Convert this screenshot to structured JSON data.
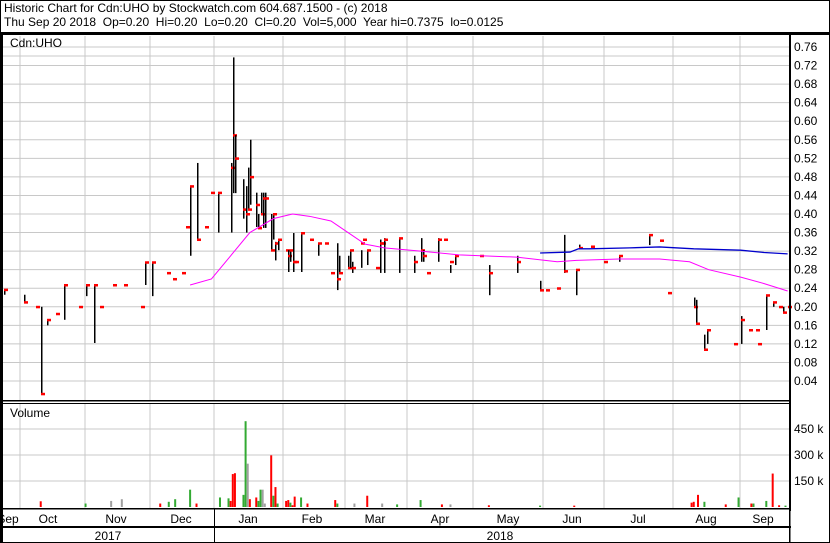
{
  "header": {
    "line1": "Historic Chart for Cdn:UHO by Stockwatch.com 604.687.1500 - (c) 2018",
    "line2": "Thu Sep 20 2018  Op=0.20  Hi=0.20  Lo=0.20  Cl=0.20  Vol=5,000  Year hi=0.7375  lo=0.0125"
  },
  "colors": {
    "close_tick": "#ff0000",
    "bar": "#000000",
    "ma_short": "#ff00ff",
    "ma_long": "#0000cc",
    "vol_up": "#33aa33",
    "vol_down": "#ff0000",
    "vol_flat": "#a0a0a0",
    "grid": "#c8c8c8"
  },
  "chart_data": [
    {
      "type": "ohlc",
      "title": "Cdn:UHO",
      "ylim": [
        0,
        0.78
      ],
      "y_ticks": [
        "0.04",
        "0.08",
        "0.12",
        "0.16",
        "0.20",
        "0.24",
        "0.28",
        "0.32",
        "0.36",
        "0.40",
        "0.44",
        "0.48",
        "0.52",
        "0.56",
        "0.60",
        "0.64",
        "0.68",
        "0.72",
        "0.76"
      ],
      "grid": true,
      "bars_fields": [
        "date",
        "high",
        "low",
        "close"
      ],
      "bars": [
        [
          "2017-09-12",
          0.237,
          0.226,
          0.237
        ],
        [
          "2017-09-21",
          0.226,
          0.21,
          0.21
        ],
        [
          "2017-09-27",
          0.2,
          0.2,
          0.2
        ],
        [
          "2017-09-29",
          0.2,
          0.0125,
          0.0125
        ],
        [
          "2017-10-02",
          0.172,
          0.16,
          0.172
        ],
        [
          "2017-10-06",
          0.185,
          0.185,
          0.185
        ],
        [
          "2017-10-10",
          0.247,
          0.172,
          0.247
        ],
        [
          "2017-10-17",
          0.2,
          0.2,
          0.2
        ],
        [
          "2017-10-20",
          0.247,
          0.223,
          0.247
        ],
        [
          "2017-10-24",
          0.247,
          0.122,
          0.247
        ],
        [
          "2017-10-27",
          0.2,
          0.2,
          0.2
        ],
        [
          "2017-11-02",
          0.247,
          0.247,
          0.247
        ],
        [
          "2017-11-07",
          0.247,
          0.247,
          0.247
        ],
        [
          "2017-11-15",
          0.2,
          0.2,
          0.2
        ],
        [
          "2017-11-17",
          0.296,
          0.247,
          0.296
        ],
        [
          "2017-11-20",
          0.296,
          0.223,
          0.296
        ],
        [
          "2017-11-27",
          0.273,
          0.273,
          0.273
        ],
        [
          "2017-11-30",
          0.26,
          0.26,
          0.26
        ],
        [
          "2017-12-04",
          0.273,
          0.273,
          0.273
        ],
        [
          "2017-12-06",
          0.372,
          0.372,
          0.372
        ],
        [
          "2017-12-08",
          0.46,
          0.31,
          0.46
        ],
        [
          "2017-12-11",
          0.51,
          0.345,
          0.345
        ],
        [
          "2017-12-15",
          0.372,
          0.372,
          0.372
        ],
        [
          "2017-12-18",
          0.446,
          0.446,
          0.446
        ],
        [
          "2017-12-21",
          0.446,
          0.36,
          0.446
        ],
        [
          "2017-12-27",
          0.51,
          0.36,
          0.5
        ],
        [
          "2017-12-28",
          0.7375,
          0.445,
          0.57
        ],
        [
          "2017-12-29",
          0.57,
          0.445,
          0.52
        ],
        [
          "2018-01-02",
          0.475,
          0.39,
          0.41
        ],
        [
          "2018-01-03",
          0.46,
          0.36,
          0.4
        ],
        [
          "2018-01-04",
          0.5,
          0.41,
          0.41
        ],
        [
          "2018-01-05",
          0.56,
          0.42,
          0.48
        ],
        [
          "2018-01-08",
          0.446,
          0.372,
          0.42
        ],
        [
          "2018-01-09",
          0.4,
          0.37,
          0.37
        ],
        [
          "2018-01-10",
          0.446,
          0.4,
          0.4
        ],
        [
          "2018-01-11",
          0.446,
          0.37,
          0.434
        ],
        [
          "2018-01-12",
          0.446,
          0.37,
          0.434
        ],
        [
          "2018-01-15",
          0.4,
          0.322,
          0.322
        ],
        [
          "2018-01-16",
          0.4,
          0.345,
          0.4
        ],
        [
          "2018-01-17",
          0.34,
          0.3,
          0.337
        ],
        [
          "2018-01-18",
          0.345,
          0.322,
          0.345
        ],
        [
          "2018-01-22",
          0.322,
          0.322,
          0.322
        ],
        [
          "2018-01-23",
          0.322,
          0.275,
          0.31
        ],
        [
          "2018-01-24",
          0.322,
          0.297,
          0.322
        ],
        [
          "2018-01-25",
          0.359,
          0.275,
          0.297
        ],
        [
          "2018-01-26",
          0.297,
          0.297,
          0.297
        ],
        [
          "2018-01-29",
          0.359,
          0.275,
          0.359
        ],
        [
          "2018-02-02",
          0.345,
          0.345,
          0.345
        ],
        [
          "2018-02-06",
          0.337,
          0.31,
          0.337
        ],
        [
          "2018-02-09",
          0.337,
          0.337,
          0.337
        ],
        [
          "2018-02-12",
          0.273,
          0.273,
          0.273
        ],
        [
          "2018-02-15",
          0.337,
          0.236,
          0.26
        ],
        [
          "2018-02-16",
          0.31,
          0.273,
          0.273
        ],
        [
          "2018-02-20",
          0.31,
          0.284,
          0.284
        ],
        [
          "2018-02-21",
          0.322,
          0.284,
          0.322
        ],
        [
          "2018-02-22",
          0.297,
          0.273,
          0.284
        ],
        [
          "2018-02-26",
          0.322,
          0.284,
          0.337
        ],
        [
          "2018-02-27",
          0.345,
          0.345,
          0.345
        ],
        [
          "2018-03-01",
          0.322,
          0.29,
          0.322
        ],
        [
          "2018-03-05",
          0.284,
          0.284,
          0.284
        ],
        [
          "2018-03-07",
          0.345,
          0.273,
          0.337
        ],
        [
          "2018-03-08",
          0.337,
          0.337,
          0.337
        ],
        [
          "2018-03-09",
          0.348,
          0.273,
          0.345
        ],
        [
          "2018-03-16",
          0.348,
          0.273,
          0.348
        ],
        [
          "2018-03-23",
          0.31,
          0.273,
          0.297
        ],
        [
          "2018-03-26",
          0.348,
          0.297,
          0.322
        ],
        [
          "2018-03-27",
          0.322,
          0.297,
          0.31
        ],
        [
          "2018-03-29",
          0.273,
          0.273,
          0.273
        ],
        [
          "2018-04-03",
          0.348,
          0.297,
          0.345
        ],
        [
          "2018-04-06",
          0.345,
          0.345,
          0.345
        ],
        [
          "2018-04-09",
          0.29,
          0.273,
          0.297
        ],
        [
          "2018-04-11",
          0.31,
          0.29,
          0.31
        ],
        [
          "2018-04-23",
          0.31,
          0.31,
          0.31
        ],
        [
          "2018-04-27",
          0.29,
          0.225,
          0.273
        ],
        [
          "2018-05-10",
          0.31,
          0.273,
          0.297
        ],
        [
          "2018-05-21",
          0.256,
          0.236,
          0.236
        ],
        [
          "2018-05-24",
          0.236,
          0.236,
          0.236
        ],
        [
          "2018-05-29",
          0.24,
          0.24,
          0.24
        ],
        [
          "2018-06-01",
          0.355,
          0.273,
          0.277
        ],
        [
          "2018-06-07",
          0.28,
          0.225,
          0.28
        ],
        [
          "2018-06-08",
          0.334,
          0.327,
          0.327
        ],
        [
          "2018-06-14",
          0.33,
          0.33,
          0.33
        ],
        [
          "2018-06-20",
          0.297,
          0.297,
          0.297
        ],
        [
          "2018-06-27",
          0.31,
          0.297,
          0.31
        ],
        [
          "2018-07-11",
          0.355,
          0.333,
          0.355
        ],
        [
          "2018-07-16",
          0.343,
          0.343,
          0.343
        ],
        [
          "2018-07-20",
          0.23,
          0.23,
          0.23
        ],
        [
          "2018-08-01",
          0.22,
          0.2,
          0.2
        ],
        [
          "2018-08-02",
          0.215,
          0.164,
          0.164
        ],
        [
          "2018-08-06",
          0.14,
          0.108,
          0.108
        ],
        [
          "2018-08-07",
          0.15,
          0.12,
          0.15
        ],
        [
          "2018-08-20",
          0.12,
          0.12,
          0.12
        ],
        [
          "2018-08-23",
          0.18,
          0.12,
          0.172
        ],
        [
          "2018-08-27",
          0.15,
          0.15,
          0.15
        ],
        [
          "2018-08-30",
          0.15,
          0.15,
          0.15
        ],
        [
          "2018-08-31",
          0.12,
          0.12,
          0.12
        ],
        [
          "2018-09-04",
          0.225,
          0.15,
          0.225
        ],
        [
          "2018-09-07",
          0.21,
          0.2,
          0.21
        ],
        [
          "2018-09-10",
          0.2,
          0.2,
          0.2
        ],
        [
          "2018-09-12",
          0.2,
          0.188,
          0.188
        ],
        [
          "2018-09-14",
          0.2,
          0.2,
          0.2
        ]
      ],
      "ma_short": [
        [
          "2017-12-08",
          0.247
        ],
        [
          "2017-12-18",
          0.26
        ],
        [
          "2017-12-27",
          0.31
        ],
        [
          "2018-01-05",
          0.36
        ],
        [
          "2018-01-16",
          0.39
        ],
        [
          "2018-01-25",
          0.4
        ],
        [
          "2018-02-02",
          0.395
        ],
        [
          "2018-02-12",
          0.385
        ],
        [
          "2018-02-20",
          0.36
        ],
        [
          "2018-02-28",
          0.335
        ],
        [
          "2018-03-09",
          0.327
        ],
        [
          "2018-03-26",
          0.32
        ],
        [
          "2018-04-13",
          0.312
        ],
        [
          "2018-05-10",
          0.307
        ],
        [
          "2018-05-29",
          0.297
        ],
        [
          "2018-06-07",
          0.3
        ],
        [
          "2018-06-27",
          0.303
        ],
        [
          "2018-07-16",
          0.303
        ],
        [
          "2018-07-30",
          0.297
        ],
        [
          "2018-08-08",
          0.28
        ],
        [
          "2018-08-23",
          0.264
        ],
        [
          "2018-09-03",
          0.25
        ],
        [
          "2018-09-14",
          0.234
        ]
      ],
      "ma_long": [
        [
          "2018-05-21",
          0.316
        ],
        [
          "2018-06-04",
          0.318
        ],
        [
          "2018-06-08",
          0.325
        ],
        [
          "2018-06-13",
          0.325
        ],
        [
          "2018-07-02",
          0.327
        ],
        [
          "2018-07-16",
          0.329
        ],
        [
          "2018-08-01",
          0.325
        ],
        [
          "2018-08-23",
          0.322
        ],
        [
          "2018-09-03",
          0.317
        ],
        [
          "2018-09-14",
          0.314
        ]
      ]
    },
    {
      "type": "bar",
      "title": "Volume",
      "ylim": [
        0,
        500000
      ],
      "y_ticks": [
        "150 k",
        "300 k",
        "450 k"
      ],
      "fields": [
        "date",
        "volume",
        "direction"
      ],
      "bars": [
        [
          "2017-09-29",
          33000,
          "down"
        ],
        [
          "2017-10-20",
          20000,
          "up"
        ],
        [
          "2017-11-01",
          35000,
          "flat"
        ],
        [
          "2017-11-06",
          45000,
          "flat"
        ],
        [
          "2017-11-24",
          20000,
          "down"
        ],
        [
          "2017-11-28",
          30000,
          "up"
        ],
        [
          "2017-12-01",
          45000,
          "up"
        ],
        [
          "2017-12-08",
          100000,
          "up"
        ],
        [
          "2017-12-11",
          20000,
          "down"
        ],
        [
          "2017-12-22",
          55000,
          "up"
        ],
        [
          "2017-12-26",
          50000,
          "up"
        ],
        [
          "2017-12-27",
          35000,
          "down"
        ],
        [
          "2017-12-28",
          190000,
          "down"
        ],
        [
          "2017-12-29",
          195000,
          "down"
        ],
        [
          "2018-01-02",
          70000,
          "up"
        ],
        [
          "2018-01-03",
          495000,
          "up"
        ],
        [
          "2018-01-04",
          250000,
          "flat"
        ],
        [
          "2018-01-05",
          45000,
          "down"
        ],
        [
          "2018-01-08",
          55000,
          "down"
        ],
        [
          "2018-01-09",
          35000,
          "up"
        ],
        [
          "2018-01-10",
          100000,
          "up"
        ],
        [
          "2018-01-11",
          100000,
          "flat"
        ],
        [
          "2018-01-12",
          20000,
          "flat"
        ],
        [
          "2018-01-15",
          298000,
          "down"
        ],
        [
          "2018-01-16",
          65000,
          "up"
        ],
        [
          "2018-01-17",
          115000,
          "down"
        ],
        [
          "2018-01-18",
          20000,
          "up"
        ],
        [
          "2018-01-22",
          35000,
          "down"
        ],
        [
          "2018-01-23",
          40000,
          "down"
        ],
        [
          "2018-01-24",
          25000,
          "up"
        ],
        [
          "2018-01-25",
          10000,
          "down"
        ],
        [
          "2018-01-26",
          60000,
          "down"
        ],
        [
          "2018-01-29",
          55000,
          "up"
        ],
        [
          "2018-02-01",
          20000,
          "down"
        ],
        [
          "2018-02-14",
          40000,
          "down"
        ],
        [
          "2018-02-15",
          20000,
          "up"
        ],
        [
          "2018-02-23",
          20000,
          "flat"
        ],
        [
          "2018-03-01",
          65000,
          "down"
        ],
        [
          "2018-03-08",
          20000,
          "flat"
        ],
        [
          "2018-03-15",
          15000,
          "up"
        ],
        [
          "2018-03-26",
          40000,
          "up"
        ],
        [
          "2018-04-05",
          15000,
          "down"
        ],
        [
          "2018-04-09",
          15000,
          "flat"
        ],
        [
          "2018-04-27",
          10000,
          "down"
        ],
        [
          "2018-05-21",
          8000,
          "up"
        ],
        [
          "2018-06-06",
          8000,
          "down"
        ],
        [
          "2018-07-31",
          25000,
          "down"
        ],
        [
          "2018-08-01",
          30000,
          "down"
        ],
        [
          "2018-08-03",
          70000,
          "down"
        ],
        [
          "2018-08-06",
          30000,
          "up"
        ],
        [
          "2018-08-16",
          15000,
          "down"
        ],
        [
          "2018-08-22",
          55000,
          "up"
        ],
        [
          "2018-08-28",
          20000,
          "down"
        ],
        [
          "2018-08-29",
          20000,
          "up"
        ],
        [
          "2018-09-04",
          35000,
          "up"
        ],
        [
          "2018-09-07",
          193000,
          "down"
        ],
        [
          "2018-09-10",
          10000,
          "down"
        ],
        [
          "2018-09-13",
          8000,
          "up"
        ]
      ]
    }
  ],
  "x_axis": {
    "months": [
      "Sep",
      "Oct",
      "Nov",
      "Dec",
      "Jan",
      "Feb",
      "Mar",
      "Apr",
      "May",
      "Jun",
      "Jul",
      "Aug",
      "Sep"
    ],
    "years": [
      "2017",
      "2018"
    ]
  }
}
